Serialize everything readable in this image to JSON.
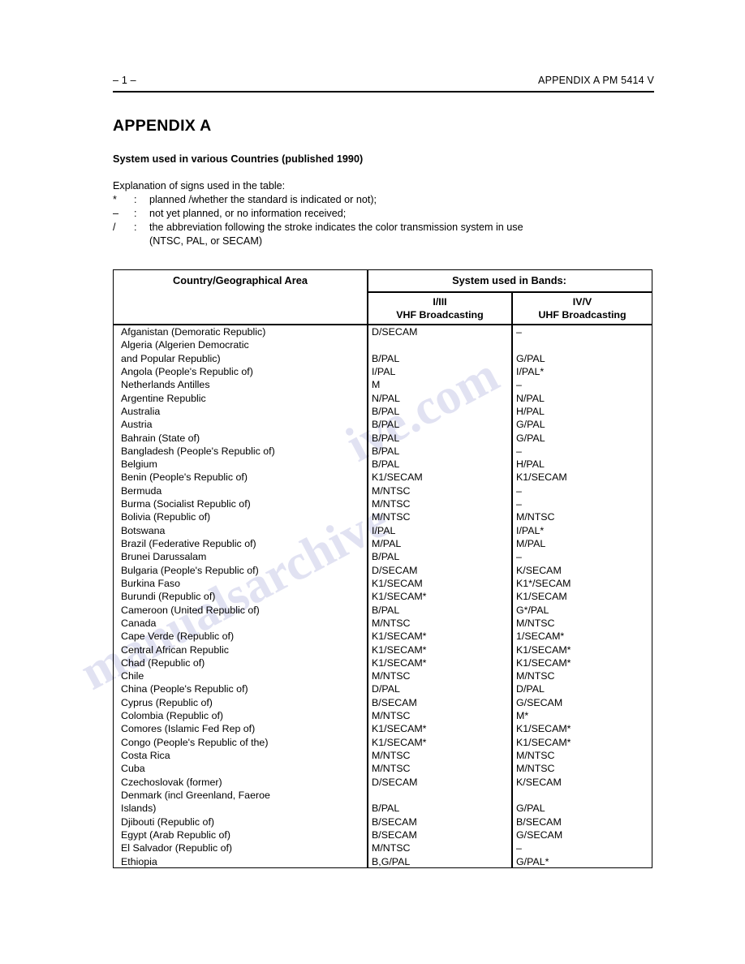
{
  "header": {
    "folio": "– 1 –",
    "doc_ref": "APPENDIX  A    PM 5414 V"
  },
  "title": "APPENDIX  A",
  "subtitle": "System used in various Countries (published 1990)",
  "legend": {
    "intro": "Explanation of signs used in the table:",
    "rows": [
      {
        "symbol": "*",
        "colon": ":",
        "text": "planned /whether the standard is indicated or not);"
      },
      {
        "symbol": "–",
        "colon": ":",
        "text": "not yet planned, or no information received;"
      },
      {
        "symbol": "/",
        "colon": ":",
        "text": "the abbreviation following the stroke indicates the color transmission system in use"
      }
    ],
    "continuation": "(NTSC, PAL, or SECAM)"
  },
  "table": {
    "headers": {
      "country": "Country/Geographical Area",
      "bands_span": "System used in Bands:",
      "vhf_line1": "I/III",
      "vhf_line2": "VHF Broadcasting",
      "uhf_line1": "IV/V",
      "uhf_line2": "UHF Broadcasting"
    },
    "rows": [
      {
        "country": "Afganistan (Demoratic Republic)",
        "vhf": "D/SECAM",
        "uhf": "–"
      },
      {
        "country": "Algeria (Algerien Democratic",
        "vhf": "",
        "uhf": ""
      },
      {
        "country": "and Popular Republic)",
        "vhf": "B/PAL",
        "uhf": "G/PAL"
      },
      {
        "country": "Angola (People's Republic of)",
        "vhf": "I/PAL",
        "uhf": "I/PAL*"
      },
      {
        "country": "Netherlands Antilles",
        "vhf": "M",
        "uhf": "–"
      },
      {
        "country": "Argentine Republic",
        "vhf": "N/PAL",
        "uhf": "N/PAL"
      },
      {
        "country": "Australia",
        "vhf": "B/PAL",
        "uhf": "H/PAL"
      },
      {
        "country": "Austria",
        "vhf": "B/PAL",
        "uhf": "G/PAL"
      },
      {
        "country": "Bahrain (State of)",
        "vhf": "B/PAL",
        "uhf": "G/PAL"
      },
      {
        "country": "Bangladesh (People's Republic of)",
        "vhf": "B/PAL",
        "uhf": "–"
      },
      {
        "country": "Belgium",
        "vhf": "B/PAL",
        "uhf": "H/PAL"
      },
      {
        "country": "Benin (People's Republic of)",
        "vhf": "K1/SECAM",
        "uhf": "K1/SECAM"
      },
      {
        "country": "Bermuda",
        "vhf": "M/NTSC",
        "uhf": "–"
      },
      {
        "country": "Burma (Socialist Republic of)",
        "vhf": "M/NTSC",
        "uhf": "–"
      },
      {
        "country": "Bolivia (Republic of)",
        "vhf": "M/NTSC",
        "uhf": "M/NTSC"
      },
      {
        "country": "Botswana",
        "vhf": "I/PAL",
        "uhf": "I/PAL*"
      },
      {
        "country": "Brazil (Federative Republic of)",
        "vhf": "M/PAL",
        "uhf": "M/PAL"
      },
      {
        "country": "Brunei Darussalam",
        "vhf": "B/PAL",
        "uhf": "–"
      },
      {
        "country": "Bulgaria (People's Republic of)",
        "vhf": "D/SECAM",
        "uhf": "K/SECAM"
      },
      {
        "country": "Burkina Faso",
        "vhf": "K1/SECAM",
        "uhf": "K1*/SECAM"
      },
      {
        "country": "Burundi (Republic of)",
        "vhf": "K1/SECAM*",
        "uhf": "K1/SECAM"
      },
      {
        "country": "Cameroon (United Republic of)",
        "vhf": "B/PAL",
        "uhf": "G*/PAL"
      },
      {
        "country": "Canada",
        "vhf": "M/NTSC",
        "uhf": "M/NTSC"
      },
      {
        "country": "Cape Verde (Republic of)",
        "vhf": "K1/SECAM*",
        "uhf": "1/SECAM*"
      },
      {
        "country": "Central African Republic",
        "vhf": "K1/SECAM*",
        "uhf": "K1/SECAM*"
      },
      {
        "country": "Chad (Republic of)",
        "vhf": "K1/SECAM*",
        "uhf": "K1/SECAM*"
      },
      {
        "country": "Chile",
        "vhf": "M/NTSC",
        "uhf": "M/NTSC"
      },
      {
        "country": "China (People's Republic of)",
        "vhf": "D/PAL",
        "uhf": "D/PAL"
      },
      {
        "country": "Cyprus (Republic of)",
        "vhf": "B/SECAM",
        "uhf": "G/SECAM"
      },
      {
        "country": "Colombia (Republic of)",
        "vhf": "M/NTSC",
        "uhf": "M*"
      },
      {
        "country": "Comores (Islamic Fed Rep of)",
        "vhf": "K1/SECAM*",
        "uhf": "K1/SECAM*"
      },
      {
        "country": "Congo (People's Republic of the)",
        "vhf": "K1/SECAM*",
        "uhf": "K1/SECAM*"
      },
      {
        "country": "Costa Rica",
        "vhf": "M/NTSC",
        "uhf": "M/NTSC"
      },
      {
        "country": "Cuba",
        "vhf": "M/NTSC",
        "uhf": "M/NTSC"
      },
      {
        "country": "Czechoslovak (former)",
        "vhf": "D/SECAM",
        "uhf": "K/SECAM"
      },
      {
        "country": "Denmark (incl Greenland, Faeroe",
        "vhf": "",
        "uhf": ""
      },
      {
        "country": "Islands)",
        "vhf": "B/PAL",
        "uhf": "G/PAL"
      },
      {
        "country": "Djibouti (Republic of)",
        "vhf": "B/SECAM",
        "uhf": "B/SECAM"
      },
      {
        "country": "Egypt (Arab Republic of)",
        "vhf": "B/SECAM",
        "uhf": "G/SECAM"
      },
      {
        "country": "El Salvador (Republic of)",
        "vhf": "M/NTSC",
        "uhf": "–"
      },
      {
        "country": "Ethiopia",
        "vhf": "B,G/PAL",
        "uhf": "G/PAL*"
      }
    ]
  },
  "watermark": {
    "line_a": "manualsarchive",
    "line_b": "ive.com"
  }
}
